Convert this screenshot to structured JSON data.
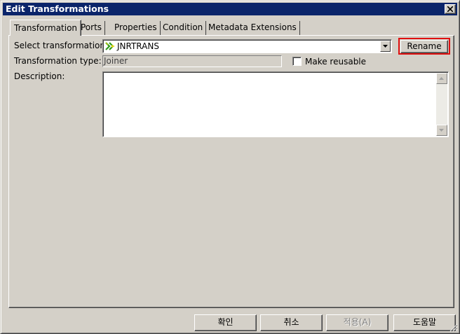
{
  "window": {
    "title": "Edit Transformations"
  },
  "tabs": [
    {
      "label": "Transformation"
    },
    {
      "label": "Ports"
    },
    {
      "label": "Properties"
    },
    {
      "label": "Condition"
    },
    {
      "label": "Metadata Extensions"
    }
  ],
  "form": {
    "select_label": "Select transformation:",
    "select_value": "JNRTRANS",
    "select_icon": "joiner-transformation-icon",
    "rename_label": "Rename",
    "type_label": "Transformation type:",
    "type_value": "Joiner",
    "reusable_label": "Make reusable",
    "reusable_checked": false,
    "description_label": "Description:",
    "description_value": ""
  },
  "footer": {
    "ok_label": "확인",
    "cancel_label": "취소",
    "apply_label": "적용(A)",
    "help_label": "도움말"
  },
  "colors": {
    "title_bar": "#0a246a",
    "face": "#d4d0c8",
    "highlight_outline": "#e01010",
    "icon_green": "#2f9a1c",
    "icon_yellow": "#e8d400"
  }
}
